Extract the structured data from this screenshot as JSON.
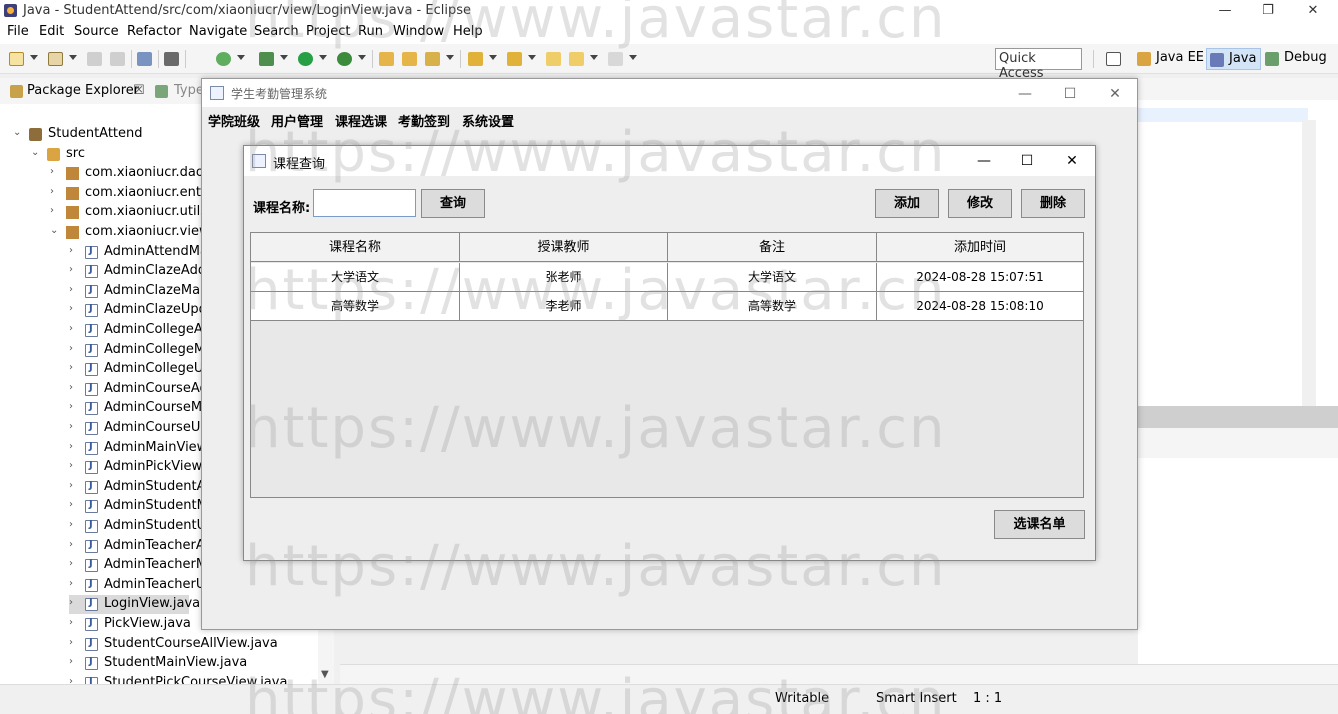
{
  "window": {
    "title": "Java - StudentAttend/src/com/xiaoniucr/view/LoginView.java - Eclipse",
    "controls": [
      "—",
      "❐",
      "✕"
    ]
  },
  "menubar": [
    "File",
    "Edit",
    "Source",
    "Refactor",
    "Navigate",
    "Search",
    "Project",
    "Run",
    "Window",
    "Help"
  ],
  "toolbar": {
    "quick_access": "Quick Access",
    "perspectives": [
      "Java EE",
      "Java",
      "Debug"
    ]
  },
  "package_explorer": {
    "tab_label": "Package Explorer",
    "tab_close": "☒",
    "tab2_label": "Type",
    "tree": [
      {
        "label": "StudentAttend",
        "type": "project",
        "level": 0,
        "expanded": true
      },
      {
        "label": "src",
        "type": "src",
        "level": 1,
        "expanded": true
      },
      {
        "label": "com.xiaoniucr.dao",
        "type": "pkg",
        "level": 2,
        "expanded": false
      },
      {
        "label": "com.xiaoniucr.entity",
        "type": "pkg",
        "level": 2,
        "expanded": false
      },
      {
        "label": "com.xiaoniucr.utils",
        "type": "pkg",
        "level": 2,
        "expanded": false
      },
      {
        "label": "com.xiaoniucr.view",
        "type": "pkg",
        "level": 2,
        "expanded": true
      },
      {
        "label": "AdminAttendMan",
        "type": "java",
        "level": 3
      },
      {
        "label": "AdminClazeAddV",
        "type": "java",
        "level": 3
      },
      {
        "label": "AdminClazeMana",
        "type": "java",
        "level": 3
      },
      {
        "label": "AdminClazeUpda",
        "type": "java",
        "level": 3
      },
      {
        "label": "AdminCollegeAdc",
        "type": "java",
        "level": 3
      },
      {
        "label": "AdminCollegeMa",
        "type": "java",
        "level": 3
      },
      {
        "label": "AdminCollegeUpc",
        "type": "java",
        "level": 3
      },
      {
        "label": "AdminCourseAdd",
        "type": "java",
        "level": 3
      },
      {
        "label": "AdminCourseMar",
        "type": "java",
        "level": 3
      },
      {
        "label": "AdminCourseUpc",
        "type": "java",
        "level": 3
      },
      {
        "label": "AdminMainView.j",
        "type": "java",
        "level": 3
      },
      {
        "label": "AdminPickView.ja",
        "type": "java",
        "level": 3
      },
      {
        "label": "AdminStudentAdc",
        "type": "java",
        "level": 3
      },
      {
        "label": "AdminStudentMa",
        "type": "java",
        "level": 3
      },
      {
        "label": "AdminStudentUpc",
        "type": "java",
        "level": 3
      },
      {
        "label": "AdminTeacherAd",
        "type": "java",
        "level": 3
      },
      {
        "label": "AdminTeacherMa",
        "type": "java",
        "level": 3
      },
      {
        "label": "AdminTeacherUp",
        "type": "java",
        "level": 3
      },
      {
        "label": "LoginView.java",
        "type": "java",
        "level": 3,
        "selected": true
      },
      {
        "label": "PickView.java",
        "type": "java",
        "level": 3
      },
      {
        "label": "StudentCourseAllView.java",
        "type": "java",
        "level": 3
      },
      {
        "label": "StudentMainView.java",
        "type": "java",
        "level": 3
      },
      {
        "label": "StudentPickCourseView.java",
        "type": "java",
        "level": 3
      }
    ]
  },
  "status_bar": {
    "writable": "Writable",
    "insert_mode": "Smart Insert",
    "position": "1 : 1"
  },
  "app_window": {
    "title": "学生考勤管理系统",
    "controls": [
      "—",
      "☐",
      "✕"
    ],
    "menus": [
      "学院班级",
      "用户管理",
      "课程选课",
      "考勤签到",
      "系统设置"
    ]
  },
  "course_query": {
    "title": "课程查询",
    "controls": [
      "—",
      "☐",
      "✕"
    ],
    "search_label": "课程名称:",
    "search_value": "",
    "search_button": "查询",
    "add_button": "添加",
    "edit_button": "修改",
    "delete_button": "删除",
    "table": {
      "headers": [
        "课程名称",
        "授课教师",
        "备注",
        "添加时间"
      ],
      "rows": [
        [
          "大学语文",
          "张老师",
          "大学语文",
          "2024-08-28 15:07:51"
        ],
        [
          "高等数学",
          "李老师",
          "高等数学",
          "2024-08-28 15:08:10"
        ]
      ]
    },
    "roster_button": "选课名单"
  },
  "watermark": "https://www.javastar.cn"
}
